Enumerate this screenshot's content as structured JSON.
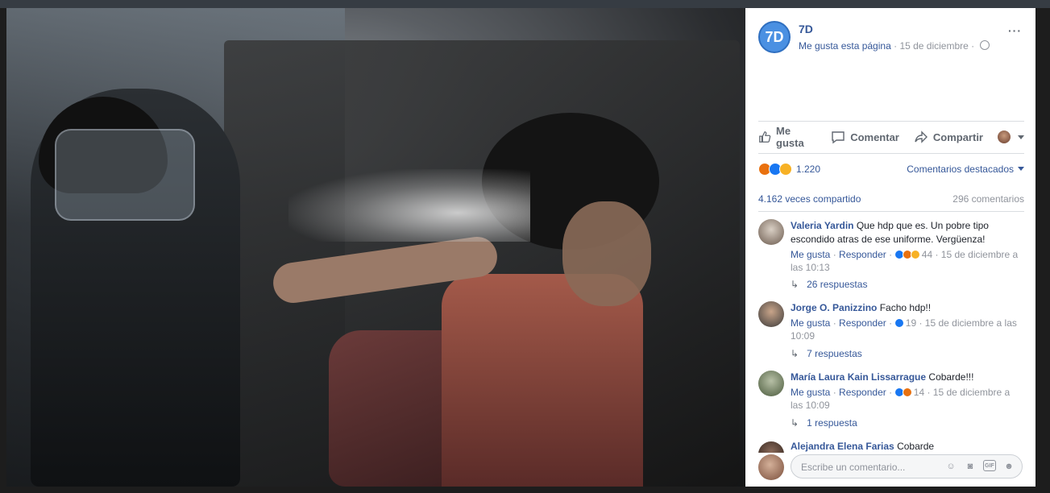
{
  "page": {
    "name": "7D",
    "logo_text": "7D",
    "like_page": "Me gusta esta página",
    "date": "15 de diciembre",
    "separator": "·",
    "more": "···"
  },
  "actions": {
    "like": "Me gusta",
    "comment": "Comentar",
    "share": "Compartir"
  },
  "reactions": {
    "count": "1.220",
    "sort": "Comentarios destacados"
  },
  "stats": {
    "shares": "4.162 veces compartido",
    "comments": "296 comentarios"
  },
  "comments": [
    {
      "author": "Valeria Yardin",
      "text": "Que hdp que es. Un pobre tipo escondido atras de ese uniforme. Vergüenza!",
      "like": "Me gusta",
      "reply": "Responder",
      "reaction_count": "44",
      "time": "15 de diciembre a las 10:13",
      "replies": "26 respuestas"
    },
    {
      "author": "Jorge O. Panizzino",
      "text": "Facho hdp!!",
      "like": "Me gusta",
      "reply": "Responder",
      "reaction_count": "19",
      "time": "15 de diciembre a las 10:09",
      "replies": "7 respuestas"
    },
    {
      "author": "María Laura Kain Lissarrague",
      "text": "Cobarde!!!",
      "like": "Me gusta",
      "reply": "Responder",
      "reaction_count": "14",
      "time": "15 de diciembre a las 10:09",
      "replies": "1 respuesta"
    },
    {
      "author": "Alejandra Elena Farias",
      "text": "Cobarde"
    }
  ],
  "composer": {
    "placeholder": "Escribe un comentario..."
  },
  "icons": {
    "like": "thumbs-up-icon",
    "comment": "speech-bubble-icon",
    "share": "share-arrow-icon",
    "globe": "globe-icon",
    "emoji": "smiley-icon",
    "camera": "camera-icon",
    "gif": "gif-icon",
    "sticker": "sticker-icon"
  },
  "colors": {
    "link": "#365899",
    "meta": "#90949c",
    "like_reaction": "#1877f2",
    "angry_reaction": "#e9710f",
    "sad_reaction": "#f7b125"
  }
}
